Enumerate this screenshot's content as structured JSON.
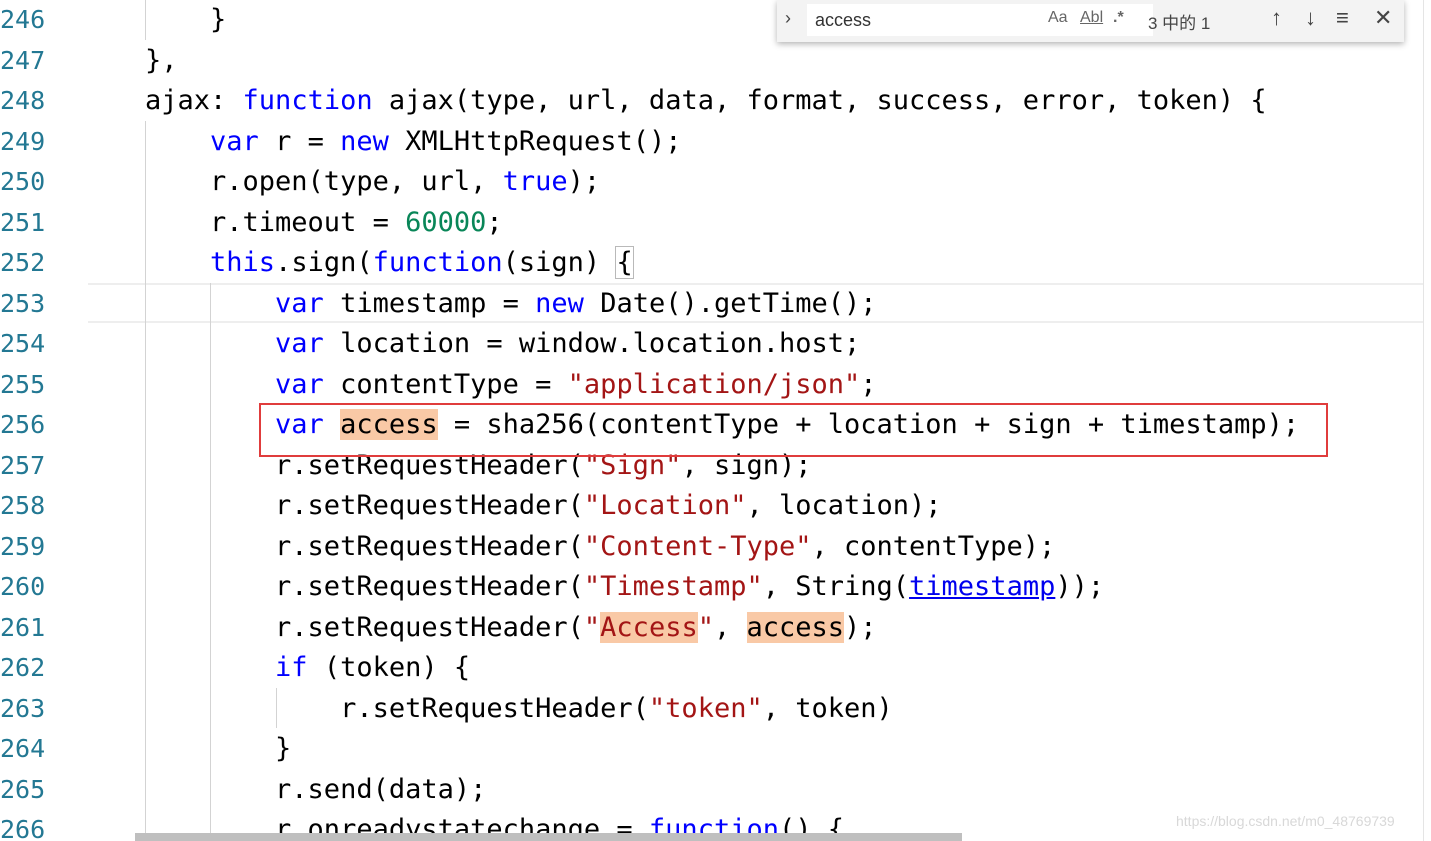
{
  "find_widget": {
    "query": "access",
    "match_case_label": "Aa",
    "whole_word_label": "Abl",
    "regex_label": ".*",
    "match_count": "3 中的 1",
    "toggle_icon": "chevron-right-icon",
    "prev_icon": "arrow-up-icon",
    "next_icon": "arrow-down-icon",
    "selection_icon": "find-in-selection-icon",
    "close_icon": "close-icon"
  },
  "line_numbers": [
    "246",
    "247",
    "248",
    "249",
    "250",
    "251",
    "252",
    "253",
    "254",
    "255",
    "256",
    "257",
    "258",
    "259",
    "260",
    "261",
    "262",
    "263",
    "264",
    "265",
    "266"
  ],
  "code": {
    "l246": {
      "t0": "    }"
    },
    "l247": {
      "t0": "},"
    },
    "l248": {
      "t0": "ajax: ",
      "t1": "function",
      "t2": " ajax(type, url, data, format, success, error, token) {"
    },
    "l249": {
      "t0": "    ",
      "t1": "var",
      "t2": " r = ",
      "t3": "new",
      "t4": " XMLHttpRequest();"
    },
    "l250": {
      "t0": "    r.open(type, url, ",
      "t1": "true",
      "t2": ");"
    },
    "l251": {
      "t0": "    r.timeout = ",
      "t1": "60000",
      "t2": ";"
    },
    "l252": {
      "t0": "    ",
      "t1": "this",
      "t2": ".sign(",
      "t3": "function",
      "t4": "(sign) ",
      "t5": "{"
    },
    "l253": {
      "t0": "        ",
      "t1": "var",
      "t2": " timestamp = ",
      "t3": "new",
      "t4": " Date().getTime();"
    },
    "l254": {
      "t0": "        ",
      "t1": "var",
      "t2": " location = window.location.host;"
    },
    "l255": {
      "t0": "        ",
      "t1": "var",
      "t2": " contentType = ",
      "t3": "\"application/json\"",
      "t4": ";"
    },
    "l256": {
      "t0": "        ",
      "t1": "var",
      "t2": " ",
      "t3": "access",
      "t4": " = sha256(contentType + location + sign + timestamp);"
    },
    "l257": {
      "t0": "        r.setRequestHeader(",
      "t1": "\"Sign\"",
      "t2": ", sign);"
    },
    "l258": {
      "t0": "        r.setRequestHeader(",
      "t1": "\"Location\"",
      "t2": ", location);"
    },
    "l259": {
      "t0": "        r.setRequestHeader(",
      "t1": "\"Content-Type\"",
      "t2": ", contentType);"
    },
    "l260": {
      "t0": "        r.setRequestHeader(",
      "t1": "\"Timestamp\"",
      "t2": ", String(",
      "t3": "timestamp",
      "t4": "));"
    },
    "l261": {
      "t0": "        r.setRequestHeader(",
      "t1": "\"",
      "t2": "Access",
      "t3": "\"",
      "t4": ", ",
      "t5": "access",
      "t6": ");"
    },
    "l262": {
      "t0": "        ",
      "t1": "if",
      "t2": " (token) {"
    },
    "l263": {
      "t0": "            r.setRequestHeader(",
      "t1": "\"token\"",
      "t2": ", token)"
    },
    "l264": {
      "t0": "        }"
    },
    "l265": {
      "t0": "        r.send(data);"
    },
    "l266": {
      "t0": "        r.onreadystatechange = ",
      "t1": "function",
      "t2": "() {"
    }
  },
  "watermark": "https://blog.csdn.net/m0_48769739"
}
